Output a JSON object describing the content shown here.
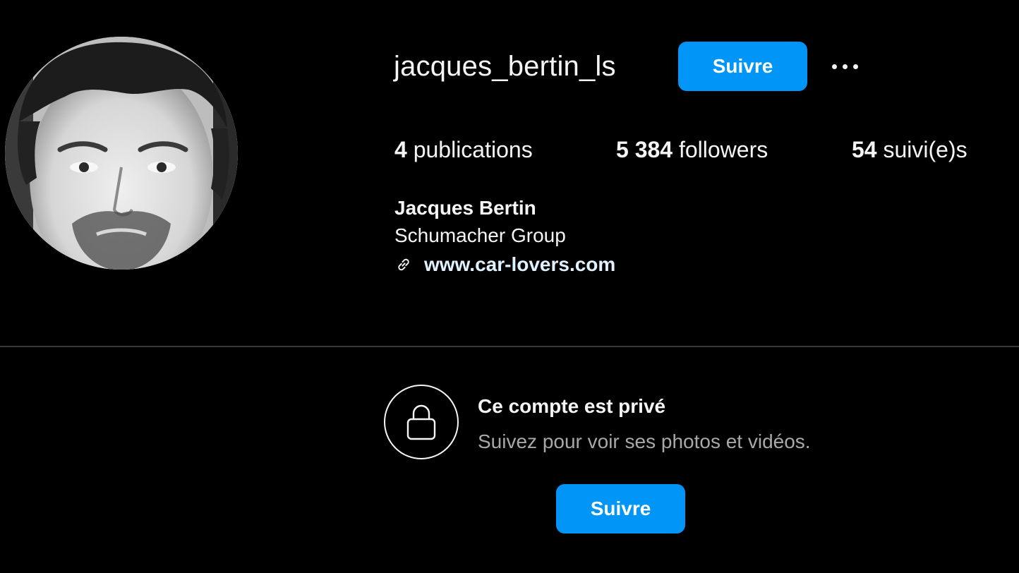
{
  "profile": {
    "username": "jacques_bertin_ls",
    "follow_label": "Suivre",
    "more_icon": "more-horizontal-icon",
    "avatar_icon": "profile-photo"
  },
  "stats": {
    "posts_count": "4",
    "posts_label": "publications",
    "followers_count": "5 384",
    "followers_label": "followers",
    "following_count": "54",
    "following_label": "suivi(e)s"
  },
  "bio": {
    "full_name": "Jacques Bertin",
    "company": "Schumacher Group",
    "link_icon": "link-icon",
    "website": "www.car-lovers.com"
  },
  "private_notice": {
    "icon": "lock-icon",
    "title": "Ce compte est privé",
    "subtitle": "Suivez pour voir ses photos et vidéos.",
    "follow_label": "Suivre"
  },
  "colors": {
    "background": "#000000",
    "text_primary": "#f5f5f5",
    "text_secondary": "#a8a8a8",
    "accent_button": "#0095f6",
    "link_text": "#e0f1ff",
    "divider": "#363636"
  }
}
